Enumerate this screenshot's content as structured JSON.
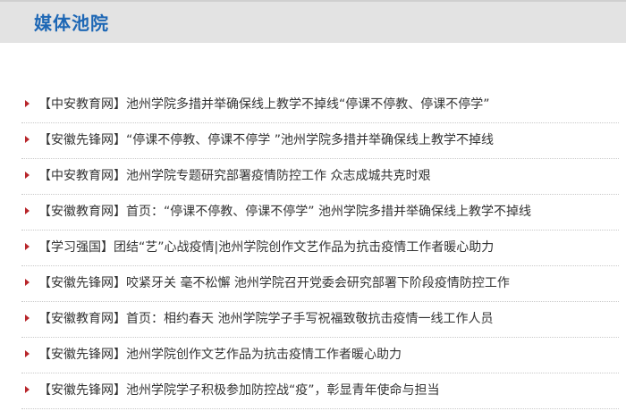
{
  "header": {
    "title": "媒体池院"
  },
  "news": {
    "items": [
      "【中安教育网】池州学院多措并举确保线上教学不掉线“停课不停教、停课不停学”",
      "【安徽先锋网】“停课不停教、停课不停学 ”池州学院多措并举确保线上教学不掉线",
      "【中安教育网】池州学院专题研究部署疫情防控工作 众志成城共克时艰",
      "【安徽教育网】首页：“停课不停教、停课不停学” 池州学院多措并举确保线上教学不掉线",
      "【学习强国】团结“艺”心战疫情|池州学院创作文艺作品为抗击疫情工作者暖心助力",
      "【安徽先锋网】咬紧牙关 毫不松懈 池州学院召开党委会研究部署下阶段疫情防控工作",
      "【安徽教育网】首页：相约春天 池州学院学子手写祝福致敬抗击疫情一线工作人员",
      "【安徽先锋网】池州学院创作文艺作品为抗击疫情工作者暖心助力",
      "【安徽先锋网】池州学院学子积极参加防控战“疫”，彰显青年使命与担当"
    ]
  },
  "colors": {
    "title": "#1d67b5",
    "bullet": "#b8262b",
    "header_bg": "#e3e3e3",
    "text": "#333333"
  }
}
